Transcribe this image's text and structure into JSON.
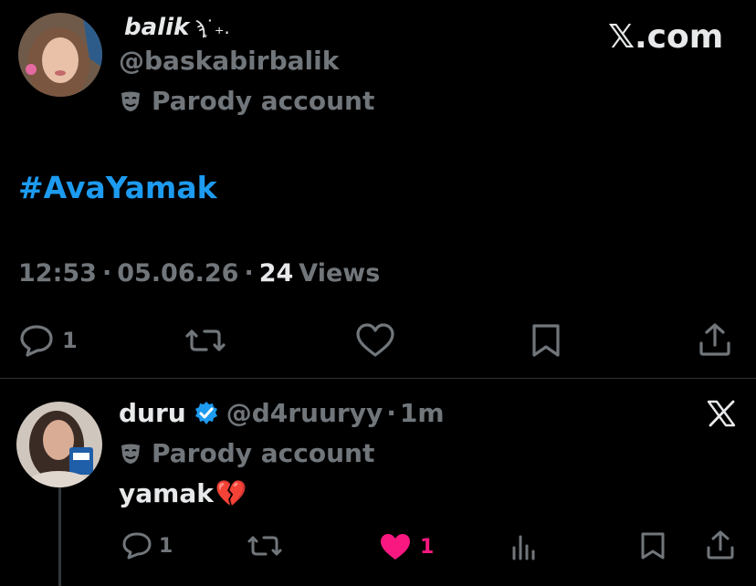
{
  "brand": {
    "wordmark": "𝕏.com"
  },
  "tweet": {
    "author": {
      "display_name": "balik",
      "name_decor": "ϡ͙˙₊.",
      "handle": "@baskabirbalik",
      "badge_label": "Parody account"
    },
    "hashtag": "#AvaYamak",
    "meta": {
      "time": "12:53",
      "sep1": "·",
      "date": "05.06.26",
      "sep2": "·",
      "views_count": "24",
      "views_label": "Views"
    },
    "actions": {
      "reply_count": "1"
    }
  },
  "reply": {
    "author": {
      "display_name": "duru",
      "handle": "@d4ruuryy",
      "sep": "·",
      "time_ago": "1m",
      "badge_label": "Parody account"
    },
    "text": "yamak",
    "emoji": "💔",
    "actions": {
      "reply_count": "1",
      "like_count": "1"
    }
  },
  "colors": {
    "background": "#000000",
    "text": "#e7e9ea",
    "muted": "#71767b",
    "link": "#1d9bf0",
    "like": "#f91880",
    "divider": "#2f3336",
    "verified": "#1d9bf0"
  }
}
